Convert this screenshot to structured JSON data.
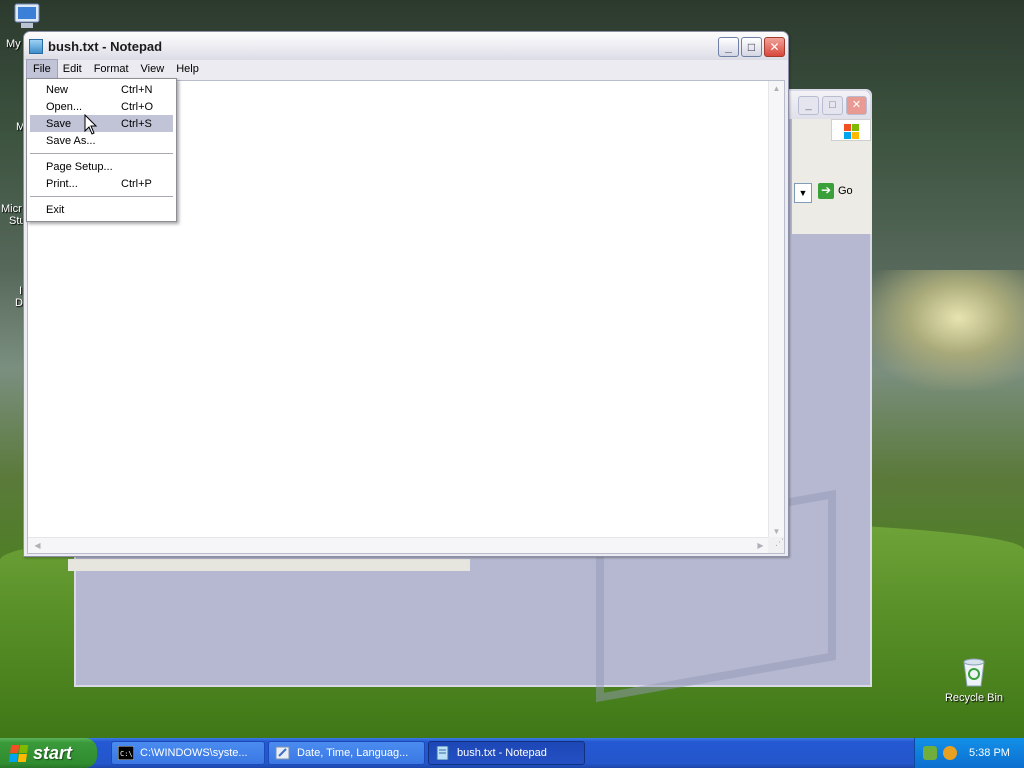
{
  "desktop": {
    "icons": [
      {
        "name": "my-computer",
        "label": "My"
      },
      {
        "name": "recycle-bin",
        "label": "Recycle Bin"
      }
    ],
    "partial_labels": [
      "M",
      "Micr",
      "Stu",
      "I",
      "D"
    ]
  },
  "background_window": {
    "go_label": "Go"
  },
  "notepad": {
    "title": "bush.txt - Notepad",
    "menubar": [
      "File",
      "Edit",
      "Format",
      "View",
      "Help"
    ],
    "file_menu": {
      "items": [
        {
          "label": "New",
          "shortcut": "Ctrl+N"
        },
        {
          "label": "Open...",
          "shortcut": "Ctrl+O"
        },
        {
          "label": "Save",
          "shortcut": "Ctrl+S",
          "highlighted": true
        },
        {
          "label": "Save As...",
          "shortcut": ""
        },
        {
          "label": "Page Setup...",
          "shortcut": ""
        },
        {
          "label": "Print...",
          "shortcut": "Ctrl+P"
        },
        {
          "label": "Exit",
          "shortcut": ""
        }
      ]
    },
    "content": ""
  },
  "taskbar": {
    "start_label": "start",
    "tasks": [
      {
        "label": "C:\\WINDOWS\\syste...",
        "icon": "cmd-icon",
        "active": false
      },
      {
        "label": "Date, Time, Languag...",
        "icon": "control-panel-icon",
        "active": false
      },
      {
        "label": "bush.txt - Notepad",
        "icon": "notepad-icon",
        "active": true
      }
    ],
    "clock": "5:38 PM"
  },
  "colors": {
    "taskbar_blue": "#2356cc",
    "start_green": "#3a9a3a",
    "menu_highlight": "#c1c3d6",
    "close_red": "#d9473b"
  }
}
